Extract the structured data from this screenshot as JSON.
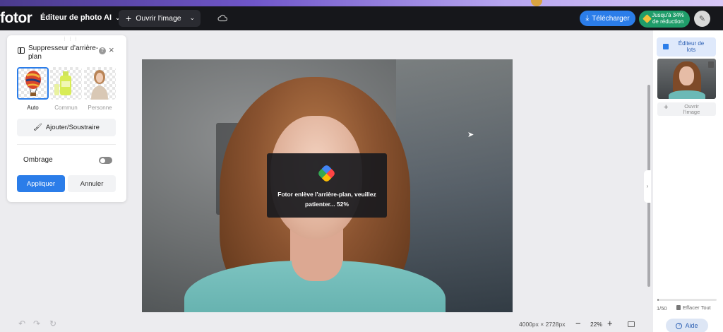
{
  "header": {
    "logo": "fotor",
    "menu_label": "Éditeur de photo AI",
    "open_image_label": "Ouvrir l'image",
    "download_label": "Télécharger",
    "promo_line1": "Jusqu'à 34%",
    "promo_line2": "de réduction"
  },
  "panel": {
    "title": "Suppresseur d'arrière-plan",
    "modes": [
      {
        "label": "Auto",
        "selected": true
      },
      {
        "label": "Commun",
        "selected": false
      },
      {
        "label": "Personne",
        "selected": false
      }
    ],
    "add_subtract_label": "Ajouter/Soustraire",
    "shadow_label": "Ombrage",
    "shadow_on": false,
    "apply_label": "Appliquer",
    "cancel_label": "Annuler"
  },
  "overlay": {
    "message": "Fotor enlève l'arrière-plan, veuillez patienter... 52%",
    "progress_percent": 52
  },
  "right_panel": {
    "batch_line1": "Éditeur de",
    "batch_line2": "lots",
    "open_line1": "Ouvrir",
    "open_line2": "l'image",
    "count": "1/50",
    "count_fraction": 0.02,
    "clear_all_label": "Effacer Tout",
    "help_label": "Aide"
  },
  "bottom": {
    "dimensions": "4000px × 2728px",
    "zoom": "22%"
  },
  "colors": {
    "accent": "#2b7de9",
    "header_bg": "#16171b",
    "promo": "#1f9d6a"
  }
}
